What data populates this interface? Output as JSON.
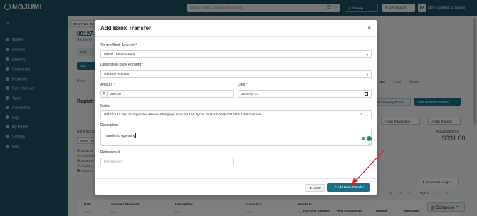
{
  "app": {
    "logo_text": "NOJUMI",
    "search_placeholder": "Search matters, entities and invoices",
    "search_filter_icon": "☰",
    "search_icon": "⌕",
    "timer_label": "Timer",
    "get_support_label": "Get Support",
    "avatar_initials": "BA",
    "firm_name": "Stern, Lockhart & Gardner"
  },
  "sidebar": {
    "collapse_icon": "»",
    "items": [
      {
        "label": "Matters",
        "icon": "briefcase-icon"
      },
      {
        "label": "Persons",
        "icon": "person-icon"
      },
      {
        "label": "Lawyers",
        "icon": "lawyer-icon"
      },
      {
        "label": "Companies",
        "icon": "building-icon"
      },
      {
        "label": "Properties",
        "icon": "house-icon"
      },
      {
        "label": "Firm Calendar",
        "icon": "calendar-icon"
      },
      {
        "label": "Tasks",
        "icon": "checklist-icon"
      },
      {
        "label": "Accounting",
        "icon": "ledger-icon"
      },
      {
        "label": "Logs",
        "icon": "log-icon"
      },
      {
        "label": "My Profile",
        "icon": "user-icon"
      },
      {
        "label": "Settings",
        "icon": "gear-icon"
      },
      {
        "label": "Help",
        "icon": "help-icon"
      }
    ],
    "accounting_arrow": "›"
  },
  "background": {
    "crumb_tab": "00127-123 Test",
    "case_title": "00127-1",
    "case_sub": "Private M",
    "update_label": "Upd",
    "open_label": "Ope",
    "home_label": "Home",
    "registers_label": "Registr",
    "tabs": [
      "ons",
      "Logs",
      "Usage"
    ],
    "add_outgoing": "Add Outgoing Funds",
    "add_transfer_request": "Add Transfer Request",
    "add_transaction": "Add Transaction",
    "add_transfer": "Add Transfer",
    "actual_balance_label": "Actual Balance",
    "actual_balance_value": "$331.00",
    "bank_account_label": "Bank accou",
    "bank_account_value": "Mixed Tru",
    "legend": [
      "Expecte",
      "Received",
      "Expecte",
      "Actual U",
      "Reconcil"
    ],
    "download_ledger": "Download Ledger",
    "pager": [
      "10",
      "«",
      "‹",
      "Page 1",
      "›",
      "»"
    ],
    "table_headers": [
      "Date",
      "Source / Recipient",
      "Description",
      "Funds Out",
      "Funds In",
      "Running Balance",
      "View Documents",
      "Upload",
      "Messages"
    ],
    "filter_placeholder": "Filter...",
    "compose_label": "Compose"
  },
  "modal": {
    "title": "Add Bank Transfer",
    "close_icon": "×",
    "source_label": "Source Bank Account",
    "source_value": "Mixed Trust Account",
    "dest_label": "Destination Bank Account",
    "dest_value": "General Account",
    "amount_label": "Amount",
    "amount_prefix": "$",
    "amount_value": "250.00",
    "date_label": "Date",
    "date_value": "2026-02-21",
    "matter_label": "Matter",
    "matter_value": "00127-123 Test Incorporated-Private Mortgage Loan on 160 Tycos Dr North York ON M6B 1W8 Canada",
    "description_label": "Description",
    "description_value": "Transfer to operating",
    "reference_label": "Reference #",
    "reference_placeholder": "Reference #",
    "required_mark": "*",
    "close_button": "✖ Close",
    "add_button": "✔ Add Bank Transfer"
  },
  "colors": {
    "brand_dark": "#1d4f63",
    "primary_button": "#1d6e85",
    "annotation_arrow": "#d62828",
    "required": "#d23b3b"
  }
}
